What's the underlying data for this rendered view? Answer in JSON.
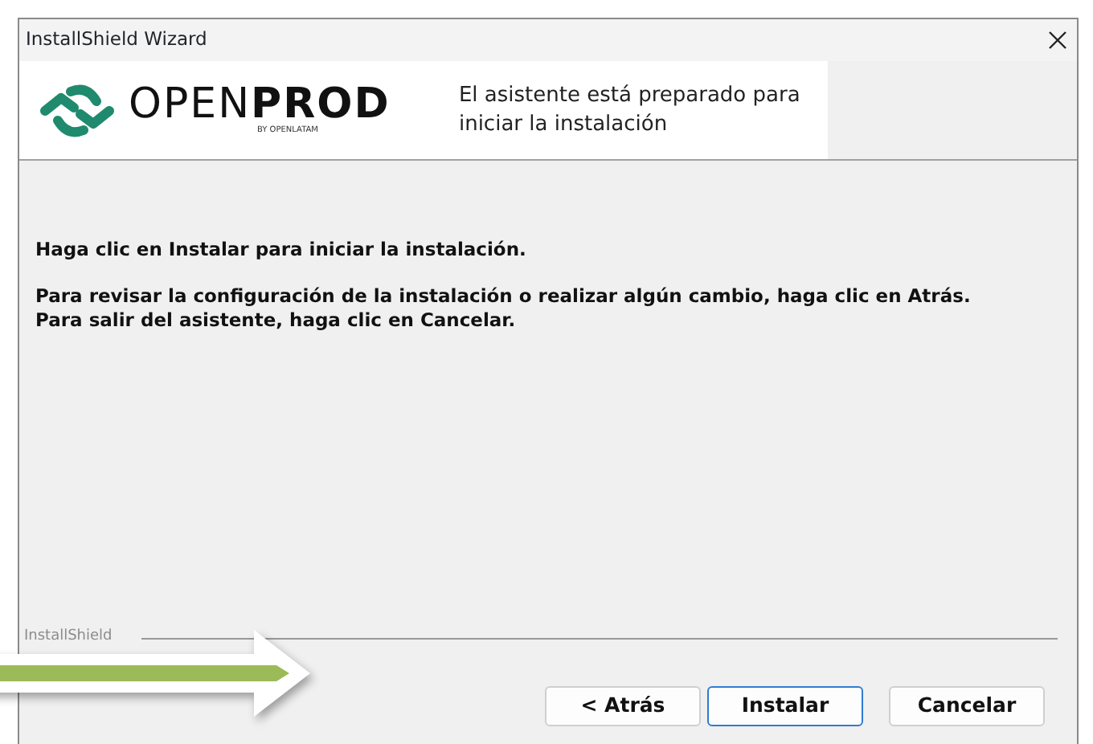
{
  "window": {
    "title": "InstallShield Wizard"
  },
  "header": {
    "logo": {
      "light": "OPEN",
      "bold": "PROD",
      "byline": "BY OPENLATAM"
    },
    "title": "El asistente está preparado para iniciar la instalación"
  },
  "body": {
    "paragraphs": [
      "Haga clic en Instalar para iniciar la instalación.",
      "Para revisar la configuración de la instalación o realizar algún cambio, haga clic en Atrás. Para salir del asistente, haga clic en Cancelar."
    ]
  },
  "brand_label": "InstallShield",
  "buttons": [
    {
      "label": "< Atrás",
      "default": false
    },
    {
      "label": "Instalar",
      "default": true
    },
    {
      "label": "Cancelar",
      "default": false
    }
  ]
}
